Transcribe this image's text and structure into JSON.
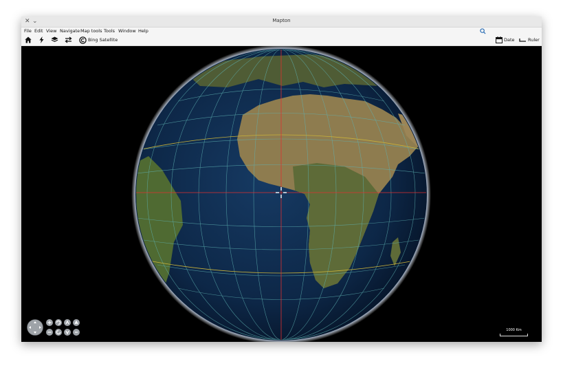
{
  "window": {
    "title": "Mapton",
    "close_glyph": "✕",
    "menu_glyph": "⌄"
  },
  "menubar": {
    "items": [
      "File",
      "Edit",
      "View",
      "Navigate",
      "Map tools",
      "Tools",
      "Window",
      "Help"
    ],
    "search_icon": "search-icon"
  },
  "toolbar": {
    "home_icon": "home-icon",
    "bolt_icon": "bolt-icon",
    "layers_icon": "layers-icon",
    "swap_icon": "swap-arrows-icon",
    "basemap_icon": "copyright-icon",
    "basemap_label": "Bing Satellite",
    "date_label": "Date",
    "ruler_label": "Ruler"
  },
  "map": {
    "scale_label": "1000 Km",
    "colors": {
      "ocean": "#0c1e3a",
      "land": "#5d6a3a",
      "desert": "#a88f5e",
      "grid": "#5fb3b3",
      "tropics": "#c9b23a",
      "axis": "#e03030"
    }
  }
}
